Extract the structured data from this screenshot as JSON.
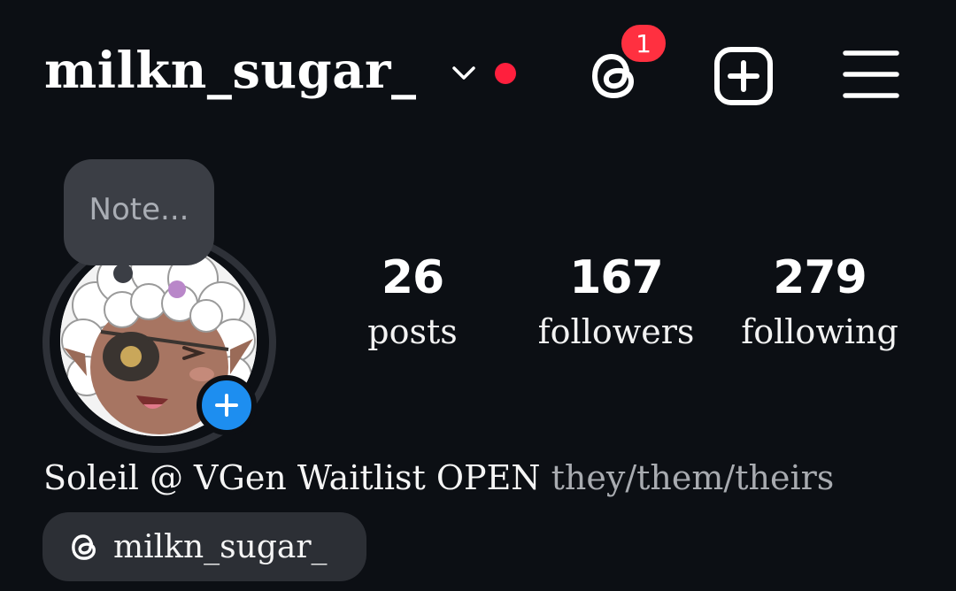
{
  "header": {
    "username": "milkn_sugar_",
    "icons": {
      "dropdown": "chevron-down-icon",
      "threads": "threads-icon",
      "new_post": "plus-square-icon",
      "menu": "hamburger-menu-icon"
    },
    "threads_badge_count": "1",
    "colors": {
      "unread_dot": "#ff1f3d",
      "badge": "#ff3040"
    }
  },
  "note": {
    "placeholder": "Note..."
  },
  "profile": {
    "add_story_icon": "plus-icon",
    "story_button_color": "#1d8ef0"
  },
  "stats": {
    "posts": {
      "value": "26",
      "label": "posts"
    },
    "followers": {
      "value": "167",
      "label": "followers"
    },
    "following": {
      "value": "279",
      "label": "following"
    }
  },
  "bio": {
    "name": "Soleil @ VGen Waitlist OPEN",
    "pronouns": "they/them/theirs"
  },
  "threads_link": {
    "icon": "threads-icon",
    "label": "milkn_sugar_"
  },
  "theme": {
    "background": "#0c0f14",
    "chip": "#2c2f35"
  }
}
